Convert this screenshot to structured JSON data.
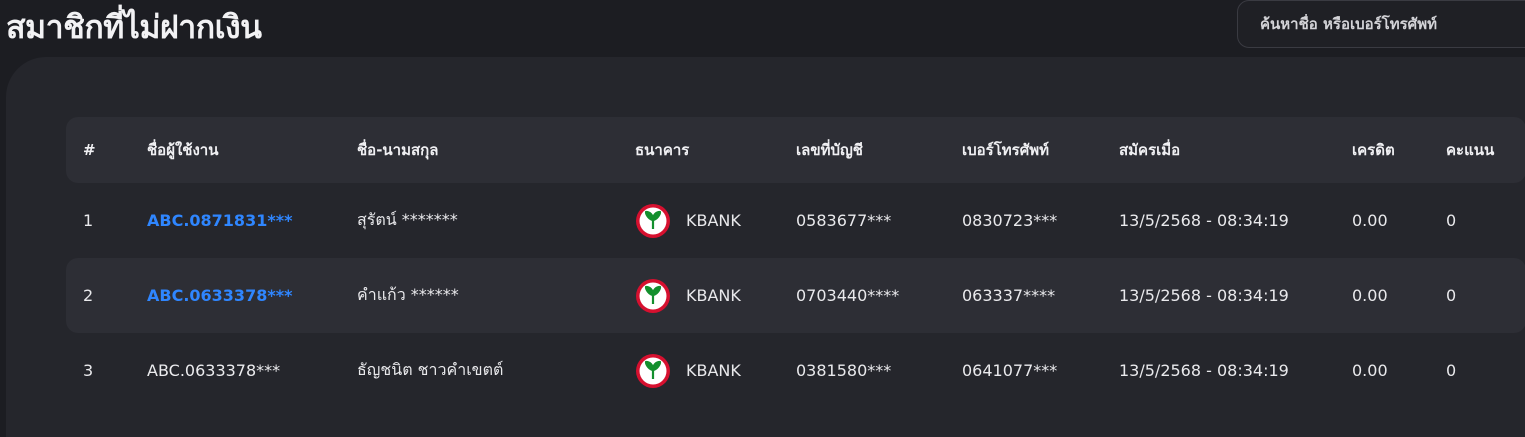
{
  "page": {
    "title": "สมาชิกที่ไม่ฝากเงิน"
  },
  "search": {
    "placeholder": "ค้นหาชื่อ หรือเบอร์โทรศัพท์",
    "value": ""
  },
  "table": {
    "headers": {
      "num": "#",
      "username": "ชื่อผู้ใช้งาน",
      "fullname": "ชื่อ-นามสกุล",
      "bank": "ธนาคาร",
      "account": "เลขที่บัญชี",
      "phone": "เบอร์โทรศัพท์",
      "registered": "สมัครเมื่อ",
      "credit": "เครดิต",
      "score": "คะแนน"
    },
    "rows": [
      {
        "num": "1",
        "username": "ABC.0871831***",
        "username_link": true,
        "fullname": "สุรัตน์ *******",
        "bank": "KBANK",
        "bank_icon": "kbank-logo-icon",
        "account": "0583677***",
        "phone": "0830723***",
        "registered": "13/5/2568 - 08:34:19",
        "credit": "0.00",
        "score": "0"
      },
      {
        "num": "2",
        "username": "ABC.0633378***",
        "username_link": true,
        "fullname": "คำแก้ว ******",
        "bank": "KBANK",
        "bank_icon": "kbank-logo-icon",
        "account": "0703440****",
        "phone": "063337****",
        "registered": "13/5/2568 - 08:34:19",
        "credit": "0.00",
        "score": "0"
      },
      {
        "num": "3",
        "username": "ABC.0633378***",
        "username_link": false,
        "fullname": "ธัญชนิต ชาวคำเขตต์",
        "bank": "KBANK",
        "bank_icon": "kbank-logo-icon",
        "account": "0381580***",
        "phone": "0641077***",
        "registered": "13/5/2568 - 08:34:19",
        "credit": "0.00",
        "score": "0"
      }
    ]
  },
  "colors": {
    "background": "#1c1d22",
    "panel": "#25262c",
    "row_shade": "#2d2e35",
    "link": "#2f86ff",
    "kbank_green": "#138f2d",
    "kbank_ring": "#d6102f"
  }
}
